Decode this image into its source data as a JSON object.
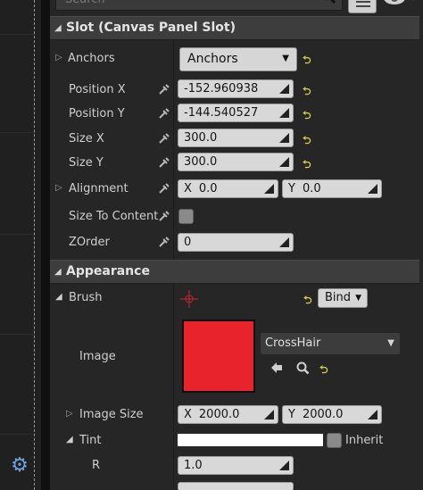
{
  "search": {
    "placeholder": "Search"
  },
  "sections": {
    "slot": {
      "title": "Slot (Canvas Panel Slot)"
    },
    "appearance": {
      "title": "Appearance"
    }
  },
  "slot": {
    "anchors": {
      "label": "Anchors",
      "value": "Anchors"
    },
    "position_x": {
      "label": "Position X",
      "value": "-152.960938"
    },
    "position_y": {
      "label": "Position Y",
      "value": "-144.540527"
    },
    "size_x": {
      "label": "Size X",
      "value": "300.0"
    },
    "size_y": {
      "label": "Size Y",
      "value": "300.0"
    },
    "alignment": {
      "label": "Alignment",
      "x_prefix": "X",
      "x": "0.0",
      "y_prefix": "Y",
      "y": "0.0"
    },
    "size_to_content": {
      "label": "Size To Content",
      "checked": false
    },
    "zorder": {
      "label": "ZOrder",
      "value": "0"
    }
  },
  "appearance": {
    "brush": {
      "label": "Brush",
      "bind_label": "Bind"
    },
    "image": {
      "label": "Image",
      "asset": "CrossHair",
      "swatch_color": "#e8232b"
    },
    "image_size": {
      "label": "Image Size",
      "x_prefix": "X",
      "x": "2000.0",
      "y_prefix": "Y",
      "y": "2000.0"
    },
    "tint": {
      "label": "Tint",
      "inherit_label": "Inherit",
      "color": "#ffffff"
    },
    "r": {
      "label": "R",
      "value": "1.0"
    }
  },
  "icons": {
    "search": "search-icon",
    "view_options": "eye-icon",
    "settings": "gear-icon",
    "reset": "reset-arrow-icon",
    "binding": "bind-icon",
    "crosshair": "crosshair-icon",
    "use_selected": "arrow-left-icon",
    "browse": "magnifier-icon"
  },
  "colors": {
    "accent": "#d4c84a",
    "swatch": "#e8232b",
    "gear": "#6fa3e0"
  }
}
